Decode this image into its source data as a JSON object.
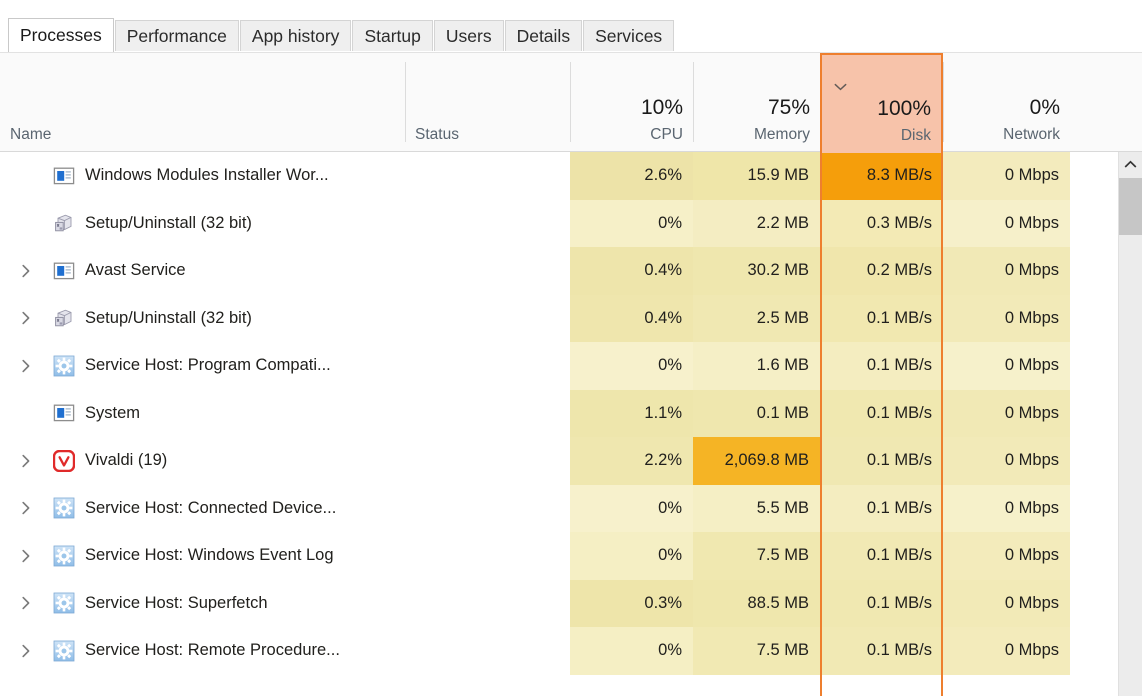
{
  "tabs": [
    {
      "label": "Processes",
      "active": true
    },
    {
      "label": "Performance",
      "active": false
    },
    {
      "label": "App history",
      "active": false
    },
    {
      "label": "Startup",
      "active": false
    },
    {
      "label": "Users",
      "active": false
    },
    {
      "label": "Details",
      "active": false
    },
    {
      "label": "Services",
      "active": false
    }
  ],
  "columns": {
    "name": {
      "label": "Name",
      "pct": ""
    },
    "status": {
      "label": "Status",
      "pct": ""
    },
    "cpu": {
      "label": "CPU",
      "pct": "10%"
    },
    "memory": {
      "label": "Memory",
      "pct": "75%"
    },
    "disk": {
      "label": "Disk",
      "pct": "100%",
      "sorted": true,
      "sort_direction": "descending"
    },
    "network": {
      "label": "Network",
      "pct": "0%"
    }
  },
  "colors": {
    "sort_header_bg": "#F7C3AA",
    "sort_border": "#EE7F2E",
    "heat_high": "#F59E0B",
    "heat_mid": "#F0C33C",
    "heat_low": "#F2EBBE",
    "heat_row_a": "#EDE3A8",
    "heat_row_b": "#F5EFC6"
  },
  "rows": [
    {
      "name": "Windows Modules Installer Wor...",
      "icon": "window-icon",
      "expandable": false,
      "status": "",
      "cpu": "2.6%",
      "memory": "15.9 MB",
      "disk": "8.3 MB/s",
      "network": "0 Mbps",
      "cpu_heat": "#EDE3A8",
      "memory_heat": "#EFE6A9",
      "disk_heat": "#F59E0B",
      "network_heat": "#F3EBBD"
    },
    {
      "name": "Setup/Uninstall (32 bit)",
      "icon": "setup-icon",
      "expandable": false,
      "status": "",
      "cpu": "0%",
      "memory": "2.2 MB",
      "disk": "0.3 MB/s",
      "network": "0 Mbps",
      "cpu_heat": "#F6F0C8",
      "memory_heat": "#F4EDC2",
      "disk_heat": "#F3EAB5",
      "network_heat": "#F6F0CA"
    },
    {
      "name": "Avast Service",
      "icon": "window-icon",
      "expandable": true,
      "status": "",
      "cpu": "0.4%",
      "memory": "30.2 MB",
      "disk": "0.2 MB/s",
      "network": "0 Mbps",
      "cpu_heat": "#EEE5AB",
      "memory_heat": "#EFE7AE",
      "disk_heat": "#F0E6AC",
      "network_heat": "#F1E9B6"
    },
    {
      "name": "Setup/Uninstall (32 bit)",
      "icon": "setup-icon",
      "expandable": true,
      "status": "",
      "cpu": "0.4%",
      "memory": "2.5 MB",
      "disk": "0.1 MB/s",
      "network": "0 Mbps",
      "cpu_heat": "#EFE6AD",
      "memory_heat": "#F0E8B2",
      "disk_heat": "#F1E8B0",
      "network_heat": "#F2EAB8"
    },
    {
      "name": "Service Host: Program Compati...",
      "icon": "gear-icon",
      "expandable": true,
      "status": "",
      "cpu": "0%",
      "memory": "1.6 MB",
      "disk": "0.1 MB/s",
      "network": "0 Mbps",
      "cpu_heat": "#F7F1CC",
      "memory_heat": "#F5EFC6",
      "disk_heat": "#F4EDC0",
      "network_heat": "#F6F1CB"
    },
    {
      "name": "System",
      "icon": "window-icon",
      "expandable": false,
      "status": "",
      "cpu": "1.1%",
      "memory": "0.1 MB",
      "disk": "0.1 MB/s",
      "network": "0 Mbps",
      "cpu_heat": "#EEE6AC",
      "memory_heat": "#EFE7AE",
      "disk_heat": "#F0E8B0",
      "network_heat": "#F1E9B5"
    },
    {
      "name": "Vivaldi (19)",
      "icon": "vivaldi-icon",
      "expandable": true,
      "status": "",
      "cpu": "2.2%",
      "memory": "2,069.8 MB",
      "disk": "0.1 MB/s",
      "network": "0 Mbps",
      "cpu_heat": "#EFE7AF",
      "memory_heat": "#F5B425",
      "disk_heat": "#F0E8B2",
      "network_heat": "#F2EAB8"
    },
    {
      "name": "Service Host: Connected Device...",
      "icon": "gear-icon",
      "expandable": true,
      "status": "",
      "cpu": "0%",
      "memory": "5.5 MB",
      "disk": "0.1 MB/s",
      "network": "0 Mbps",
      "cpu_heat": "#F7F1CC",
      "memory_heat": "#F5EFC5",
      "disk_heat": "#F4EDC0",
      "network_heat": "#F6F1CA"
    },
    {
      "name": "Service Host: Windows Event Log",
      "icon": "gear-icon",
      "expandable": true,
      "status": "",
      "cpu": "0%",
      "memory": "7.5 MB",
      "disk": "0.1 MB/s",
      "network": "0 Mbps",
      "cpu_heat": "#F5EFC4",
      "memory_heat": "#F0E8B0",
      "disk_heat": "#F1E9B4",
      "network_heat": "#F3EBBB"
    },
    {
      "name": "Service Host: Superfetch",
      "icon": "gear-icon",
      "expandable": true,
      "status": "",
      "cpu": "0.3%",
      "memory": "88.5 MB",
      "disk": "0.1 MB/s",
      "network": "0 Mbps",
      "cpu_heat": "#EEE5AA",
      "memory_heat": "#EFE7AD",
      "disk_heat": "#F0E8B1",
      "network_heat": "#F2EAB7"
    },
    {
      "name": "Service Host: Remote Procedure...",
      "icon": "gear-icon",
      "expandable": true,
      "status": "",
      "cpu": "0%",
      "memory": "7.5 MB",
      "disk": "0.1 MB/s",
      "network": "0 Mbps",
      "cpu_heat": "#F5EFC4",
      "memory_heat": "#F1E9B3",
      "disk_heat": "#F1E9B4",
      "network_heat": "#F3EBBB"
    }
  ]
}
